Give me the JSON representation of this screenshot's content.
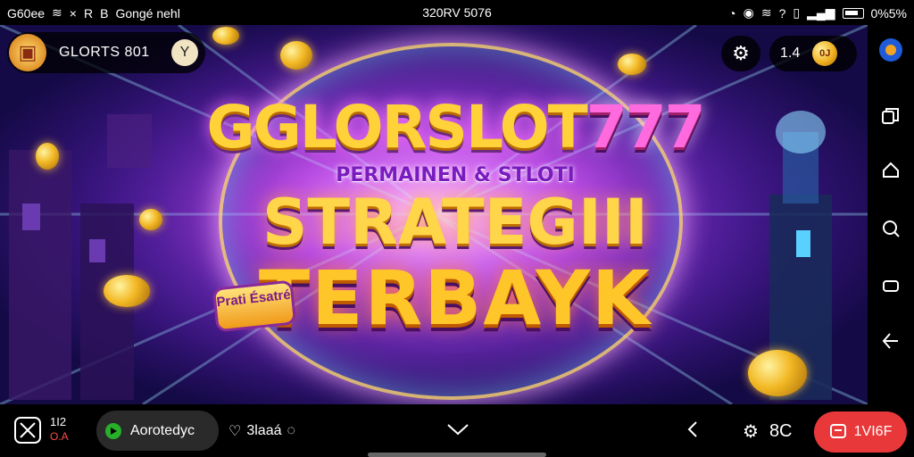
{
  "status_bar": {
    "left_text": "G60ee",
    "left_extra": "Gongé nehl",
    "center_text": "320RV 5076",
    "battery_text": "0%5%"
  },
  "hud": {
    "profile_name": "GLORTS 801",
    "chip_glyph": "Y",
    "balance_value": "1.4",
    "coin_label": "0J"
  },
  "banner": {
    "logo_main": "GGLORSLOT",
    "logo_num": "777",
    "subtitle": "PERMAINEN & STLOTI",
    "strategy": "STRATEGIII",
    "big_word": "TERBAYK",
    "badge": "Prati Ésatré"
  },
  "bottom_bar": {
    "count_top": "1I2",
    "count_bottom": "O.A",
    "pill_label": "Aorotedyc",
    "link_label": "3laaá",
    "gear_label": "8C",
    "red_button_label": "1VI6F"
  },
  "colors": {
    "accent_red": "#e8383a",
    "gold": "#ffd23a",
    "purple": "#7a1bbf"
  }
}
